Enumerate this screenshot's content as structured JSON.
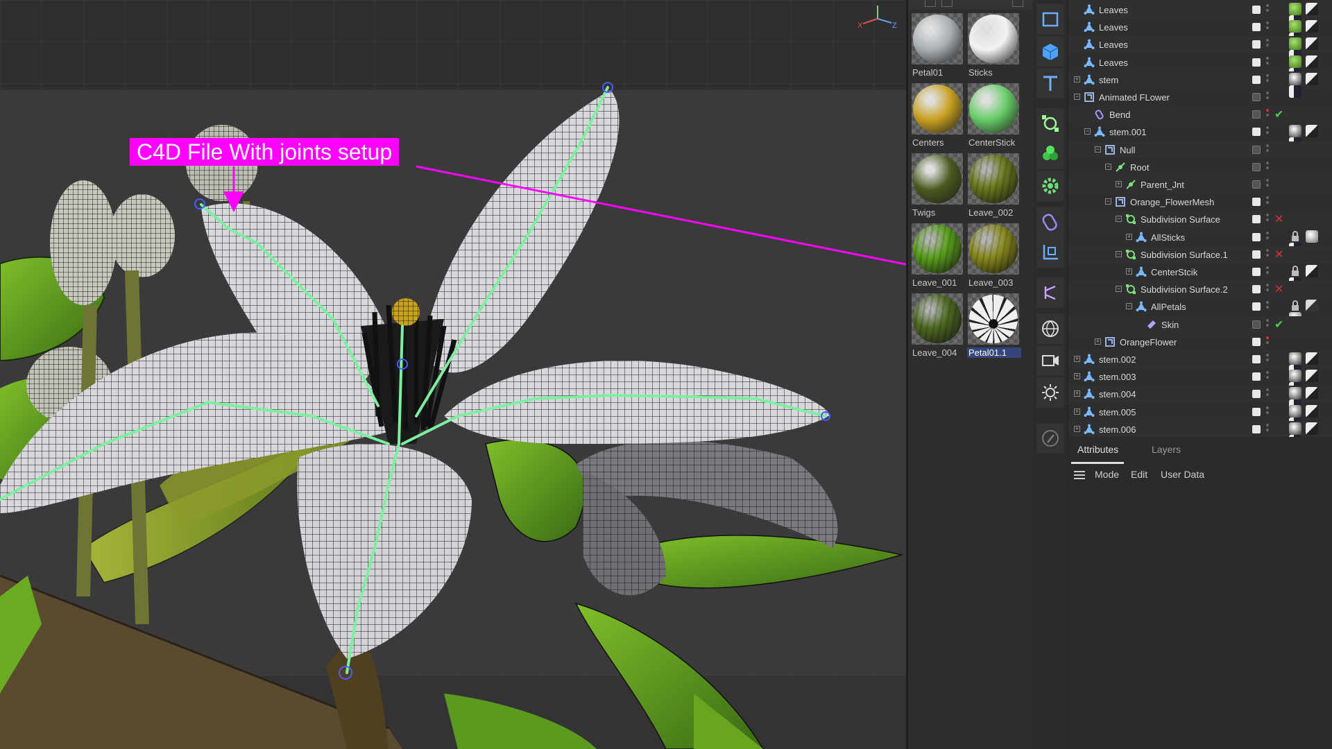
{
  "viewport": {
    "annotation_text": "C4D File With joints setup",
    "axis_labels": {
      "x": "X",
      "y": "Y",
      "z": "Z"
    }
  },
  "materials": [
    {
      "label": "Petal01",
      "color": "#a9aeb3",
      "kind": "matte"
    },
    {
      "label": "Sticks",
      "color": "#f2f2f2",
      "kind": "white"
    },
    {
      "label": "Centers",
      "color": "#c8a020",
      "kind": "gold"
    },
    {
      "label": "CenterStick",
      "color": "#66cc66",
      "kind": "green"
    },
    {
      "label": "Twigs",
      "color": "#4a5a1e",
      "kind": "dark"
    },
    {
      "label": "Leave_002",
      "color": "#6d7a1e",
      "kind": "leaf"
    },
    {
      "label": "Leave_001",
      "color": "#5aa01e",
      "kind": "leaf"
    },
    {
      "label": "Leave_003",
      "color": "#8a8a1e",
      "kind": "leaf"
    },
    {
      "label": "Leave_004",
      "color": "#4f6a22",
      "kind": "leaf"
    },
    {
      "label": "Petal01.1",
      "color": "#efefef",
      "kind": "petal",
      "selected": true
    }
  ],
  "tools": [
    "rectangle-select-icon",
    "cube-icon",
    "text-icon",
    "spline-pen-icon",
    "cloner-icon",
    "gear-generator-icon",
    "deformer-icon",
    "camera-bracket-icon",
    "scene-graph-icon",
    "world-grid-icon",
    "camera-icon",
    "light-icon",
    "pencil-icon"
  ],
  "object_tree": [
    {
      "name": "Leaves",
      "depth": 1,
      "icon": "polygon-icon",
      "expander": "",
      "vis": "white",
      "dots": "gray",
      "flag": "",
      "tags": [
        "leaf",
        "dark",
        "mat"
      ]
    },
    {
      "name": "Leaves",
      "depth": 1,
      "icon": "polygon-icon",
      "expander": "",
      "vis": "white",
      "dots": "gray",
      "flag": "",
      "tags": [
        "leaf",
        "dark",
        "mat"
      ]
    },
    {
      "name": "Leaves",
      "depth": 1,
      "icon": "polygon-icon",
      "expander": "",
      "vis": "white",
      "dots": "gray",
      "flag": "",
      "tags": [
        "leaf",
        "dark",
        "mat"
      ]
    },
    {
      "name": "Leaves",
      "depth": 1,
      "icon": "polygon-icon",
      "expander": "",
      "vis": "white",
      "dots": "gray",
      "flag": "",
      "tags": [
        "leaf",
        "dark",
        "mat"
      ]
    },
    {
      "name": "stem",
      "depth": 1,
      "icon": "polygon-icon",
      "expander": "+",
      "vis": "white",
      "dots": "gray",
      "flag": "",
      "tags": [
        "petal",
        "dark",
        "mat"
      ]
    },
    {
      "name": "Animated FLower",
      "depth": 1,
      "icon": "null-icon",
      "expander": "-",
      "vis": "gray",
      "dots": "gray",
      "flag": "",
      "tags": []
    },
    {
      "name": "Bend",
      "depth": 2,
      "icon": "bend-icon",
      "expander": "",
      "vis": "gray",
      "dots": "red",
      "flag": "check",
      "tags": []
    },
    {
      "name": "stem.001",
      "depth": 2,
      "icon": "polygon-icon",
      "expander": "-",
      "vis": "white",
      "dots": "gray",
      "flag": "",
      "tags": [
        "petal",
        "dark",
        "mat"
      ]
    },
    {
      "name": "Null",
      "depth": 3,
      "icon": "null-icon",
      "expander": "-",
      "vis": "gray",
      "dots": "gray",
      "flag": "",
      "tags": []
    },
    {
      "name": "Root",
      "depth": 4,
      "icon": "joint-icon",
      "expander": "-",
      "vis": "gray",
      "dots": "gray",
      "flag": "",
      "tags": []
    },
    {
      "name": "Parent_Jnt",
      "depth": 5,
      "icon": "joint-icon",
      "expander": "+",
      "vis": "gray",
      "dots": "gray",
      "flag": "",
      "tags": []
    },
    {
      "name": "Orange_FlowerMesh",
      "depth": 4,
      "icon": "null-icon",
      "expander": "-",
      "vis": "white",
      "dots": "gray",
      "flag": "",
      "tags": []
    },
    {
      "name": "Subdivision Surface",
      "depth": 5,
      "icon": "subdiv-icon",
      "expander": "-",
      "vis": "white",
      "dots": "gray",
      "flag": "x",
      "tags": []
    },
    {
      "name": "AllSticks",
      "depth": 6,
      "icon": "polygon-icon",
      "expander": "+",
      "vis": "white",
      "dots": "gray",
      "flag": "",
      "tags": [
        "lock",
        "white",
        "mat"
      ]
    },
    {
      "name": "Subdivision Surface.1",
      "depth": 5,
      "icon": "subdiv-icon",
      "expander": "-",
      "vis": "white",
      "dots": "gray",
      "flag": "x",
      "tags": []
    },
    {
      "name": "CenterStcik",
      "depth": 6,
      "icon": "polygon-icon",
      "expander": "+",
      "vis": "white",
      "dots": "gray",
      "flag": "",
      "tags": [
        "lock",
        "dark",
        "mat"
      ]
    },
    {
      "name": "Subdivision Surface.2",
      "depth": 5,
      "icon": "subdiv-icon",
      "expander": "-",
      "vis": "white",
      "dots": "gray",
      "flag": "x",
      "tags": []
    },
    {
      "name": "AllPetals",
      "depth": 6,
      "icon": "polygon-icon",
      "expander": "-",
      "vis": "white",
      "dots": "gray",
      "flag": "",
      "tags": [
        "lock",
        "uv",
        "white"
      ]
    },
    {
      "name": "Skin",
      "depth": 7,
      "icon": "skin-icon",
      "expander": "",
      "vis": "gray",
      "dots": "gray",
      "flag": "check",
      "tags": []
    },
    {
      "name": "OrangeFlower",
      "depth": 3,
      "icon": "null-icon",
      "expander": "+",
      "vis": "white",
      "dots": "red",
      "flag": "",
      "tags": []
    },
    {
      "name": "stem.002",
      "depth": 1,
      "icon": "polygon-icon",
      "expander": "+",
      "vis": "white",
      "dots": "gray",
      "flag": "",
      "tags": [
        "petal",
        "dark",
        "mat"
      ]
    },
    {
      "name": "stem.003",
      "depth": 1,
      "icon": "polygon-icon",
      "expander": "+",
      "vis": "white",
      "dots": "gray",
      "flag": "",
      "tags": [
        "petal",
        "dark",
        "mat"
      ]
    },
    {
      "name": "stem.004",
      "depth": 1,
      "icon": "polygon-icon",
      "expander": "+",
      "vis": "white",
      "dots": "gray",
      "flag": "",
      "tags": [
        "petal",
        "dark",
        "mat"
      ]
    },
    {
      "name": "stem.005",
      "depth": 1,
      "icon": "polygon-icon",
      "expander": "+",
      "vis": "white",
      "dots": "gray",
      "flag": "",
      "tags": [
        "petal",
        "dark",
        "mat"
      ]
    },
    {
      "name": "stem.006",
      "depth": 1,
      "icon": "polygon-icon",
      "expander": "+",
      "vis": "white",
      "dots": "gray",
      "flag": "",
      "tags": [
        "petal",
        "dark",
        "mat"
      ]
    }
  ],
  "attributes": {
    "tabs": [
      "Attributes",
      "Layers"
    ],
    "menu": [
      "Mode",
      "Edit",
      "User Data"
    ]
  },
  "colors": {
    "annotation": "#ff00ff",
    "joint_green": "#7df0a0",
    "leaf_green": "#6aa51f",
    "petal_white": "#d8d8dc",
    "selection_blue": "#34457a"
  }
}
